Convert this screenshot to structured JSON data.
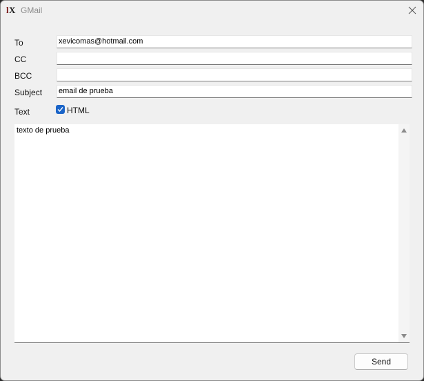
{
  "window": {
    "title": "GMail",
    "app_icon": "lx-icon",
    "close_icon": "close-icon"
  },
  "form": {
    "to_label": "To",
    "to_value": "xevicomas@hotmail.com",
    "cc_label": "CC",
    "cc_value": "",
    "bcc_label": "BCC",
    "bcc_value": "",
    "subject_label": "Subject",
    "subject_value": "email de prueba",
    "text_label": "Text",
    "html_checkbox_label": "HTML",
    "html_checked": true,
    "body_text": "texto de prueba"
  },
  "actions": {
    "send_label": "Send"
  },
  "colors": {
    "accent": "#1a64c8",
    "window_bg": "#f0f0f0"
  }
}
